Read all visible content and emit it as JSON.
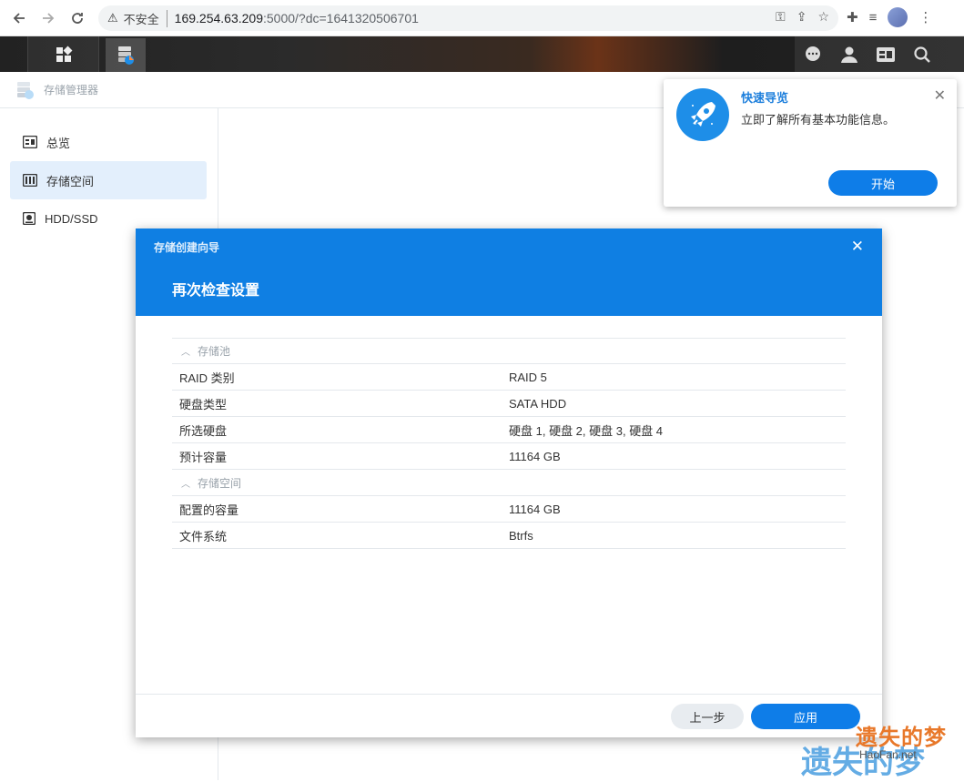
{
  "browser": {
    "insecure_label": "不安全",
    "url_host": "169.254.63.209",
    "url_rest": ":5000/?dc=1641320506701"
  },
  "app": {
    "title": "存储管理器"
  },
  "sidebar": {
    "items": [
      {
        "label": "总览",
        "icon": "overview-icon"
      },
      {
        "label": "存储空间",
        "icon": "storage-icon",
        "active": true
      },
      {
        "label": "HDD/SSD",
        "icon": "disk-icon"
      }
    ]
  },
  "guide": {
    "title": "快速导览",
    "description": "立即了解所有基本功能信息。",
    "start_label": "开始"
  },
  "wizard": {
    "small_title": "存储创建向导",
    "title": "再次检查设置",
    "groups": [
      {
        "name": "存储池",
        "rows": [
          {
            "key": "RAID 类别",
            "value": "RAID 5"
          },
          {
            "key": "硬盘类型",
            "value": "SATA HDD"
          },
          {
            "key": "所选硬盘",
            "value": "硬盘 1, 硬盘 2, 硬盘 3, 硬盘 4"
          },
          {
            "key": "预计容量",
            "value": "11164 GB"
          }
        ]
      },
      {
        "name": "存储空间",
        "rows": [
          {
            "key": "配置的容量",
            "value": "11164 GB"
          },
          {
            "key": "文件系统",
            "value": "Btrfs"
          }
        ]
      }
    ],
    "back_label": "上一步",
    "apply_label": "应用"
  },
  "watermark": {
    "text": "遗失的梦",
    "site": "HaoFan.net"
  },
  "colors": {
    "accent": "#0f7fe3",
    "sidebar_active": "#e3effc"
  }
}
